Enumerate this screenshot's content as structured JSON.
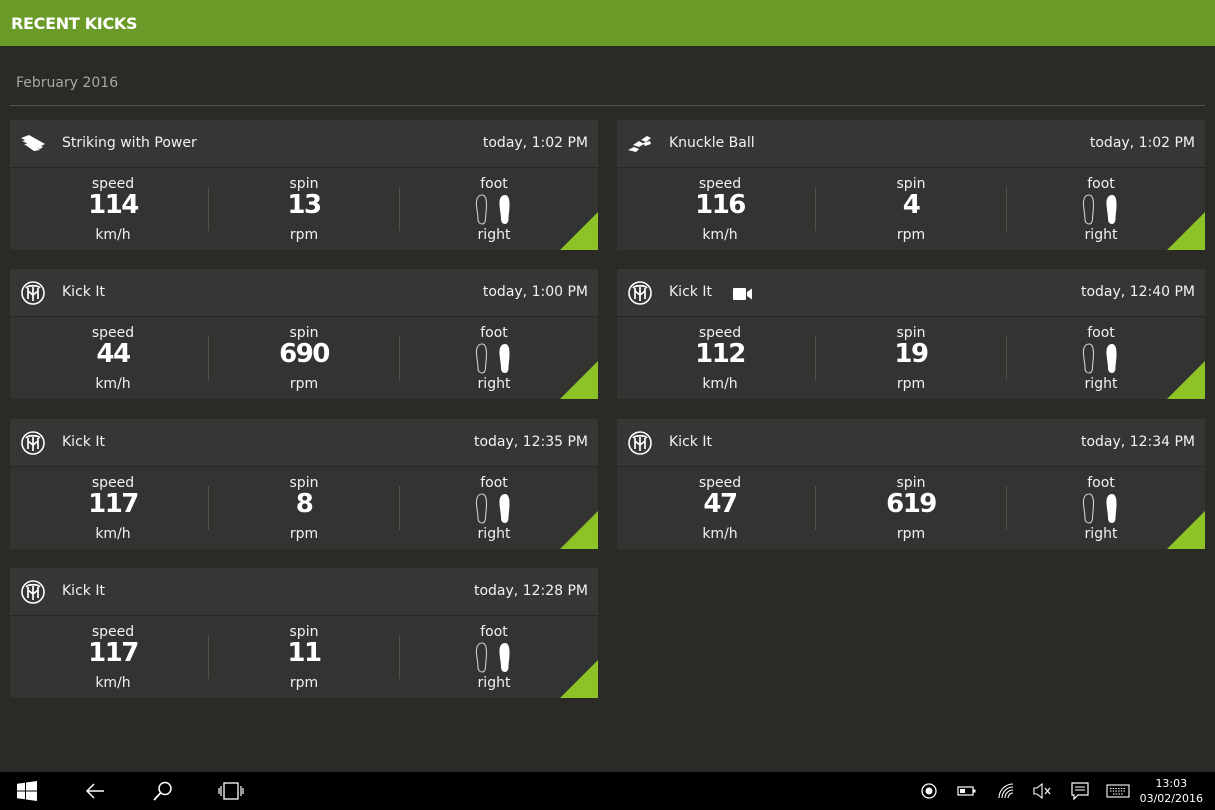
{
  "header": {
    "title": "RECENT KICKS"
  },
  "month_label": "February 2016",
  "accent_color": "#8dc326",
  "header_color": "#6a9a28",
  "kicks": [
    {
      "icon": "striking-power-icon",
      "name": "Striking with Power",
      "time": "today, 1:02 PM",
      "speed_label": "speed",
      "speed": "114",
      "speed_unit": "km/h",
      "spin_label": "spin",
      "spin": "13",
      "spin_unit": "rpm",
      "foot_label": "foot",
      "foot": "right",
      "has_video": false
    },
    {
      "icon": "knuckle-ball-icon",
      "name": "Knuckle Ball",
      "time": "today, 1:02 PM",
      "speed_label": "speed",
      "speed": "116",
      "speed_unit": "km/h",
      "spin_label": "spin",
      "spin": "4",
      "spin_unit": "rpm",
      "foot_label": "foot",
      "foot": "right",
      "has_video": false
    },
    {
      "icon": "kick-it-icon",
      "name": "Kick It",
      "time": "today, 1:00 PM",
      "speed_label": "speed",
      "speed": "44",
      "speed_unit": "km/h",
      "spin_label": "spin",
      "spin": "690",
      "spin_unit": "rpm",
      "foot_label": "foot",
      "foot": "right",
      "has_video": false
    },
    {
      "icon": "kick-it-icon",
      "name": "Kick It",
      "time": "today, 12:40 PM",
      "speed_label": "speed",
      "speed": "112",
      "speed_unit": "km/h",
      "spin_label": "spin",
      "spin": "19",
      "spin_unit": "rpm",
      "foot_label": "foot",
      "foot": "right",
      "has_video": true
    },
    {
      "icon": "kick-it-icon",
      "name": "Kick It",
      "time": "today, 12:35 PM",
      "speed_label": "speed",
      "speed": "117",
      "speed_unit": "km/h",
      "spin_label": "spin",
      "spin": "8",
      "spin_unit": "rpm",
      "foot_label": "foot",
      "foot": "right",
      "has_video": false
    },
    {
      "icon": "kick-it-icon",
      "name": "Kick It",
      "time": "today, 12:34 PM",
      "speed_label": "speed",
      "speed": "47",
      "speed_unit": "km/h",
      "spin_label": "spin",
      "spin": "619",
      "spin_unit": "rpm",
      "foot_label": "foot",
      "foot": "right",
      "has_video": false
    },
    {
      "icon": "kick-it-icon",
      "name": "Kick It",
      "time": "today, 12:28 PM",
      "speed_label": "speed",
      "speed": "117",
      "speed_unit": "km/h",
      "spin_label": "spin",
      "spin": "11",
      "spin_unit": "rpm",
      "foot_label": "foot",
      "foot": "right",
      "has_video": false
    }
  ],
  "taskbar": {
    "time": "13:03",
    "date": "03/02/2016",
    "icons": [
      "windows-start-icon",
      "back-icon",
      "search-icon",
      "task-view-icon",
      "record-icon",
      "battery-icon",
      "wifi-icon",
      "speaker-muted-icon",
      "action-center-icon",
      "keyboard-icon"
    ]
  }
}
